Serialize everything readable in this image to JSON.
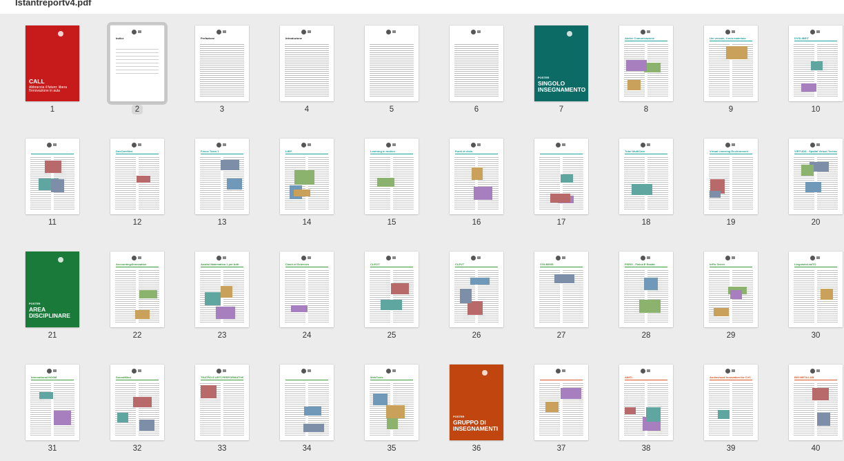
{
  "window": {
    "title": "Istantreportv4.pdf"
  },
  "selected_page": "2",
  "pages": [
    {
      "num": "1",
      "kind": "cover",
      "accent": "#c71a1a",
      "cover": {
        "small": "",
        "big": "CALL",
        "sub": "Abbraccia il futuro: libera l'innovazione in aula"
      }
    },
    {
      "num": "2",
      "kind": "index",
      "accent": "#333333",
      "title": "Indice"
    },
    {
      "num": "3",
      "kind": "text",
      "accent": "#333333",
      "title": "Prefazione"
    },
    {
      "num": "4",
      "kind": "text",
      "accent": "#333333",
      "title": "Introduzione"
    },
    {
      "num": "5",
      "kind": "text",
      "accent": "#333333",
      "title": ""
    },
    {
      "num": "6",
      "kind": "text",
      "accent": "#333333",
      "title": ""
    },
    {
      "num": "7",
      "kind": "cover",
      "accent": "#0d6b66",
      "cover": {
        "small": "POSTER",
        "big": "SINGOLO INSEGNAMENTO",
        "sub": ""
      }
    },
    {
      "num": "8",
      "kind": "poster",
      "accent": "#1aa39a",
      "title": "Atelier Comunicazione"
    },
    {
      "num": "9",
      "kind": "poster",
      "accent": "#1aa39a",
      "title": "Uni versale, il mio materiale"
    },
    {
      "num": "10",
      "kind": "poster",
      "accent": "#1aa39a",
      "title": "DYSLIBEIT"
    },
    {
      "num": "11",
      "kind": "poster",
      "accent": "#1aa39a",
      "title": ""
    },
    {
      "num": "12",
      "kind": "poster",
      "accent": "#1aa39a",
      "title": "DocCareMed"
    },
    {
      "num": "13",
      "kind": "poster",
      "accent": "#1aa39a",
      "title": "Focus Team 1"
    },
    {
      "num": "14",
      "kind": "poster",
      "accent": "#1aa39a",
      "title": "LIBP"
    },
    {
      "num": "15",
      "kind": "poster",
      "accent": "#1aa39a",
      "title": "Learning in motion"
    },
    {
      "num": "16",
      "kind": "poster",
      "accent": "#1aa39a",
      "title": "Punti di vista"
    },
    {
      "num": "17",
      "kind": "poster",
      "accent": "#1aa39a",
      "title": ""
    },
    {
      "num": "18",
      "kind": "poster",
      "accent": "#1aa39a",
      "title": "Tutor MultiCare"
    },
    {
      "num": "19",
      "kind": "poster",
      "accent": "#1aa39a",
      "title": "Virtual Learning Environment"
    },
    {
      "num": "20",
      "kind": "poster",
      "accent": "#1aa39a",
      "title": "VIRTUDS - Spatial Virtual Technology"
    },
    {
      "num": "21",
      "kind": "cover",
      "accent": "#1a7a3a",
      "cover": {
        "small": "POSTER",
        "big": "AREA DISCIPLINARE",
        "sub": ""
      }
    },
    {
      "num": "22",
      "kind": "poster",
      "accent": "#3a9a3a",
      "title": "Accounting4Innovation"
    },
    {
      "num": "23",
      "kind": "poster",
      "accent": "#3a9a3a",
      "title": "Analisi Matematica 1 per tutti"
    },
    {
      "num": "24",
      "kind": "poster",
      "accent": "#3a9a3a",
      "title": "Clash of Sciences"
    },
    {
      "num": "25",
      "kind": "poster",
      "accent": "#3a9a3a",
      "title": "CLEOT"
    },
    {
      "num": "26",
      "kind": "poster",
      "accent": "#3a9a3a",
      "title": "CLEVT"
    },
    {
      "num": "27",
      "kind": "poster",
      "accent": "#3a9a3a",
      "title": "COLBENS"
    },
    {
      "num": "28",
      "kind": "poster",
      "accent": "#3a9a3a",
      "title": "FISRX - Fisica E Realtà"
    },
    {
      "num": "29",
      "kind": "poster",
      "accent": "#3a9a3a",
      "title": "InFIs Green"
    },
    {
      "num": "30",
      "kind": "poster",
      "accent": "#3a9a3a",
      "title": "LinguisticLabTO"
    },
    {
      "num": "31",
      "kind": "poster",
      "accent": "#3a9a3a",
      "title": "International NOSM"
    },
    {
      "num": "32",
      "kind": "poster",
      "accent": "#3a9a3a",
      "title": "SoundMind"
    },
    {
      "num": "33",
      "kind": "poster",
      "accent": "#3a9a3a",
      "title": "TEATRO E ARTI PERFORMATIVE"
    },
    {
      "num": "34",
      "kind": "poster",
      "accent": "#3a9a3a",
      "title": ""
    },
    {
      "num": "35",
      "kind": "poster",
      "accent": "#3a9a3a",
      "title": "WebTools"
    },
    {
      "num": "36",
      "kind": "cover",
      "accent": "#c0450f",
      "cover": {
        "small": "POSTER",
        "big": "GRUPPO DI INSEGNAMENTI",
        "sub": ""
      }
    },
    {
      "num": "37",
      "kind": "poster",
      "accent": "#d9531e",
      "title": ""
    },
    {
      "num": "38",
      "kind": "poster",
      "accent": "#d9531e",
      "title": "AIHTL"
    },
    {
      "num": "39",
      "kind": "poster",
      "accent": "#d9531e",
      "title": "Audiovisual Innovation for CVC"
    },
    {
      "num": "40",
      "kind": "poster",
      "accent": "#d9531e",
      "title": "BIG META LAB"
    }
  ]
}
